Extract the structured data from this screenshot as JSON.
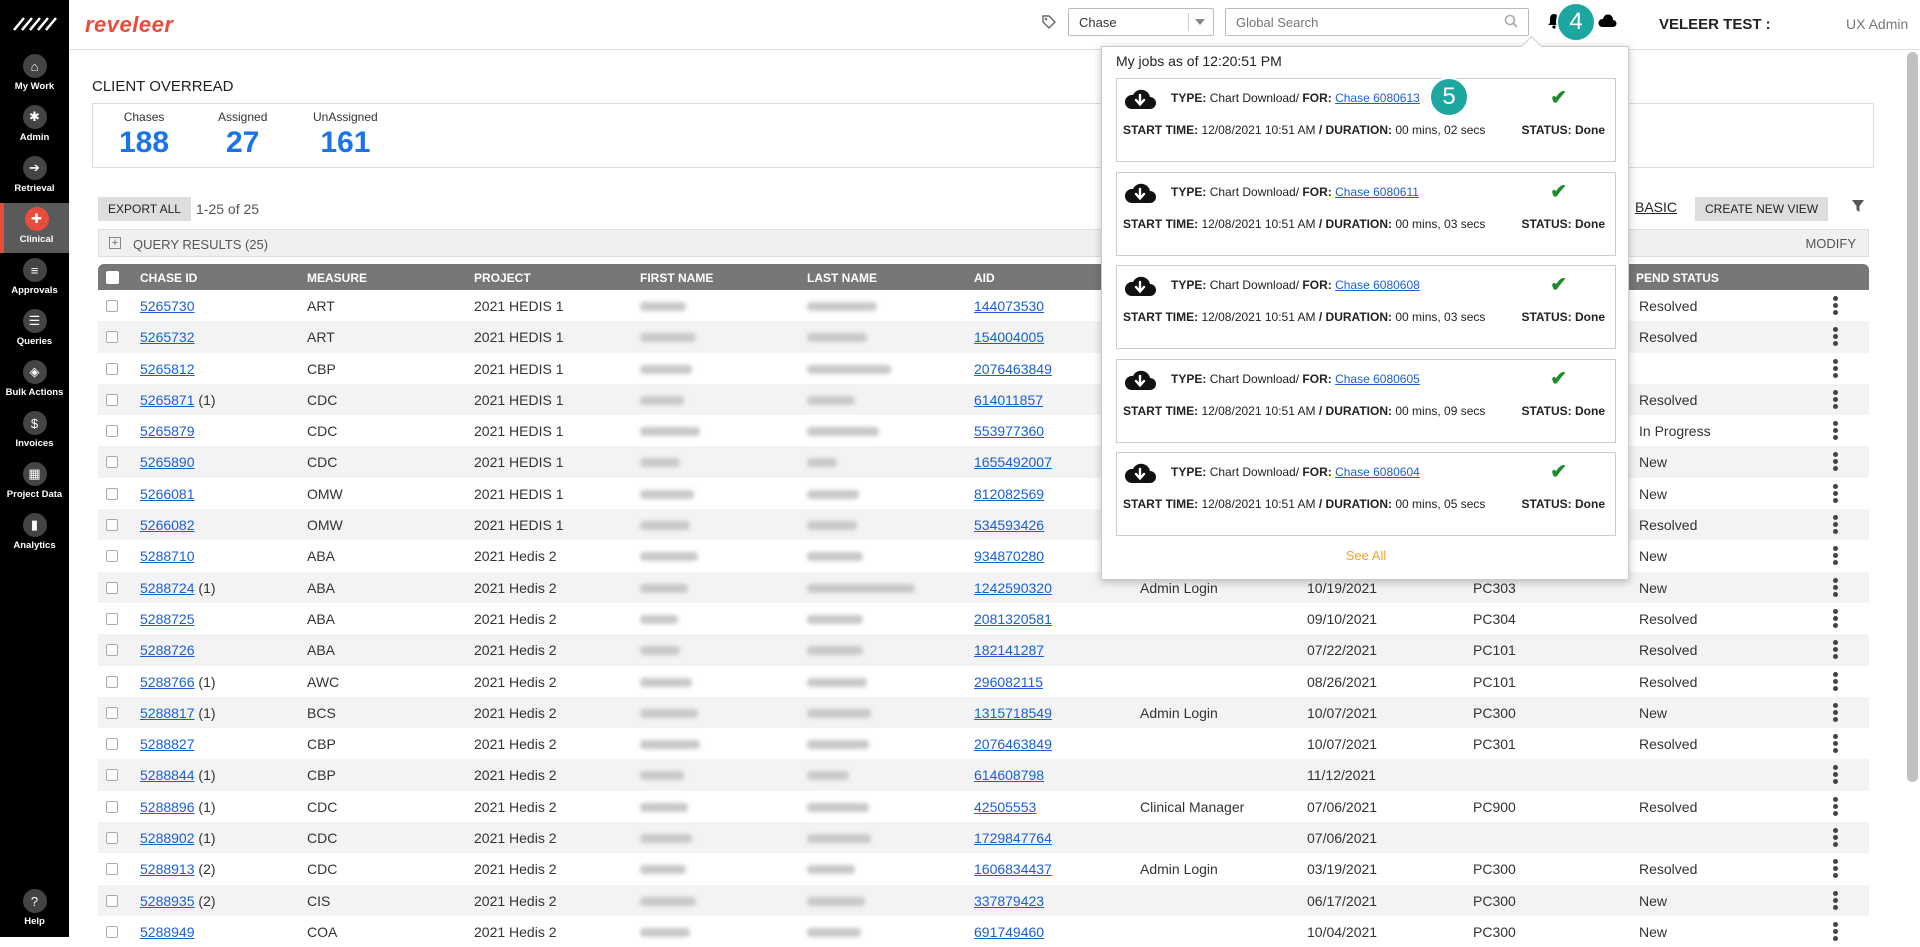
{
  "app": {
    "brand": "reveleer",
    "sidebar": [
      {
        "label": "My Work",
        "icon": "home-icon"
      },
      {
        "label": "Admin",
        "icon": "gear-icon"
      },
      {
        "label": "Retrieval",
        "icon": "arrow-right-icon"
      },
      {
        "label": "Clinical",
        "icon": "clinical-icon",
        "active": true
      },
      {
        "label": "Approvals",
        "icon": "list-icon"
      },
      {
        "label": "Queries",
        "icon": "query-icon"
      },
      {
        "label": "Bulk Actions",
        "icon": "layers-icon"
      },
      {
        "label": "Invoices",
        "icon": "dollar-icon"
      },
      {
        "label": "Project Data",
        "icon": "grid-icon"
      },
      {
        "label": "Analytics",
        "icon": "chart-icon"
      },
      {
        "label": "Help",
        "icon": "help-icon"
      }
    ]
  },
  "header": {
    "search_type": "Chase",
    "search_placeholder": "Global Search",
    "user_name": "VELEER TEST :",
    "user_role": "UX Admin",
    "step_badge_4": "4"
  },
  "page": {
    "title": "CLIENT OVERREAD",
    "stats": [
      {
        "label": "Chases",
        "value": "188"
      },
      {
        "label": "Assigned",
        "value": "27"
      },
      {
        "label": "UnAssigned",
        "value": "161"
      }
    ],
    "export_label": "EXPORT ALL",
    "paging": "1-25  of  25",
    "basic_label": "BASIC",
    "create_view_label": "CREATE NEW VIEW",
    "query_results": "QUERY RESULTS (25)",
    "modify_label": "MODIFY"
  },
  "table": {
    "columns": [
      "CHASE ID",
      "MEASURE",
      "PROJECT",
      "FIRST NAME",
      "LAST NAME",
      "AID",
      "PEND STATUS"
    ],
    "rows": [
      {
        "id": "5265730",
        "count": "",
        "measure": "ART",
        "project": "2021 HEDIS 1",
        "aid": "144073530",
        "user": "",
        "date": "",
        "pend": "",
        "status": "Resolved"
      },
      {
        "id": "5265732",
        "count": "",
        "measure": "ART",
        "project": "2021 HEDIS 1",
        "aid": "154004005",
        "user": "",
        "date": "",
        "pend": "",
        "status": "Resolved"
      },
      {
        "id": "5265812",
        "count": "",
        "measure": "CBP",
        "project": "2021 HEDIS 1",
        "aid": "2076463849",
        "user": "",
        "date": "",
        "pend": "",
        "status": ""
      },
      {
        "id": "5265871",
        "count": "(1)",
        "measure": "CDC",
        "project": "2021 HEDIS 1",
        "aid": "614011857",
        "user": "",
        "date": "",
        "pend": "",
        "status": "Resolved"
      },
      {
        "id": "5265879",
        "count": "",
        "measure": "CDC",
        "project": "2021 HEDIS 1",
        "aid": "553977360",
        "user": "",
        "date": "",
        "pend": "",
        "status": "In Progress"
      },
      {
        "id": "5265890",
        "count": "",
        "measure": "CDC",
        "project": "2021 HEDIS 1",
        "aid": "1655492007",
        "user": "",
        "date": "",
        "pend": "",
        "status": "New"
      },
      {
        "id": "5266081",
        "count": "",
        "measure": "OMW",
        "project": "2021 HEDIS 1",
        "aid": "812082569",
        "user": "",
        "date": "",
        "pend": "",
        "status": "New"
      },
      {
        "id": "5266082",
        "count": "",
        "measure": "OMW",
        "project": "2021 HEDIS 1",
        "aid": "534593426",
        "user": "",
        "date": "",
        "pend": "",
        "status": "Resolved"
      },
      {
        "id": "5288710",
        "count": "",
        "measure": "ABA",
        "project": "2021 Hedis 2",
        "aid": "934870280",
        "user": "",
        "date": "",
        "pend": "",
        "status": "New"
      },
      {
        "id": "5288724",
        "count": "(1)",
        "measure": "ABA",
        "project": "2021 Hedis 2",
        "aid": "1242590320",
        "user": "Admin Login",
        "date": "10/19/2021",
        "pend": "PC303",
        "status": "New"
      },
      {
        "id": "5288725",
        "count": "",
        "measure": "ABA",
        "project": "2021 Hedis 2",
        "aid": "2081320581",
        "user": "",
        "date": "09/10/2021",
        "pend": "PC304",
        "status": "Resolved"
      },
      {
        "id": "5288726",
        "count": "",
        "measure": "ABA",
        "project": "2021 Hedis 2",
        "aid": "182141287",
        "user": "",
        "date": "07/22/2021",
        "pend": "PC101",
        "status": "Resolved"
      },
      {
        "id": "5288766",
        "count": "(1)",
        "measure": "AWC",
        "project": "2021 Hedis 2",
        "aid": "296082115",
        "user": "",
        "date": "08/26/2021",
        "pend": "PC101",
        "status": "Resolved"
      },
      {
        "id": "5288817",
        "count": "(1)",
        "measure": "BCS",
        "project": "2021 Hedis 2",
        "aid": "1315718549",
        "user": "Admin Login",
        "date": "10/07/2021",
        "pend": "PC300",
        "status": "New"
      },
      {
        "id": "5288827",
        "count": "",
        "measure": "CBP",
        "project": "2021 Hedis 2",
        "aid": "2076463849",
        "user": "",
        "date": "10/07/2021",
        "pend": "PC301",
        "status": "Resolved"
      },
      {
        "id": "5288844",
        "count": "(1)",
        "measure": "CBP",
        "project": "2021 Hedis 2",
        "aid": "614608798",
        "user": "",
        "date": "11/12/2021",
        "pend": "",
        "status": ""
      },
      {
        "id": "5288896",
        "count": "(1)",
        "measure": "CDC",
        "project": "2021 Hedis 2",
        "aid": "42505553",
        "user": "Clinical Manager",
        "date": "07/06/2021",
        "pend": "PC900",
        "status": "Resolved"
      },
      {
        "id": "5288902",
        "count": "(1)",
        "measure": "CDC",
        "project": "2021 Hedis 2",
        "aid": "1729847764",
        "user": "",
        "date": "07/06/2021",
        "pend": "",
        "status": ""
      },
      {
        "id": "5288913",
        "count": "(2)",
        "measure": "CDC",
        "project": "2021 Hedis 2",
        "aid": "1606834437",
        "user": "Admin Login",
        "date": "03/19/2021",
        "pend": "PC300",
        "status": "Resolved"
      },
      {
        "id": "5288935",
        "count": "(2)",
        "measure": "CIS",
        "project": "2021 Hedis 2",
        "aid": "337879423",
        "user": "",
        "date": "06/17/2021",
        "pend": "PC300",
        "status": "New"
      },
      {
        "id": "5288949",
        "count": "",
        "measure": "COA",
        "project": "2021 Hedis 2",
        "aid": "691749460",
        "user": "",
        "date": "10/04/2021",
        "pend": "PC300",
        "status": "New"
      }
    ]
  },
  "jobs": {
    "title": "My jobs as of 12:20:51 PM",
    "type_label": "TYPE:",
    "type_value": "Chart Download/",
    "for_label": "FOR:",
    "start_label": "START TIME:",
    "duration_label": "/ DURATION:",
    "status_label": "STATUS: Done",
    "see_all": "See All",
    "step_badge_5": "5",
    "items": [
      {
        "chase": "Chase 6080613",
        "start": "12/08/2021 10:51 AM",
        "duration": "00 mins, 02 secs"
      },
      {
        "chase": "Chase 6080611",
        "start": "12/08/2021 10:51 AM",
        "duration": "00 mins, 03 secs"
      },
      {
        "chase": "Chase 6080608",
        "start": "12/08/2021 10:51 AM",
        "duration": "00 mins, 03 secs"
      },
      {
        "chase": "Chase 6080605",
        "start": "12/08/2021 10:51 AM",
        "duration": "00 mins, 09 secs"
      },
      {
        "chase": "Chase 6080604",
        "start": "12/08/2021 10:51 AM",
        "duration": "00 mins, 05 secs"
      }
    ]
  },
  "colors": {
    "brand": "#e84c3d",
    "link": "#1a5fd6",
    "stat": "#1a73e8",
    "badge": "#1ea7a1",
    "check": "#1e8c2a",
    "see_all": "#f0a22e"
  }
}
